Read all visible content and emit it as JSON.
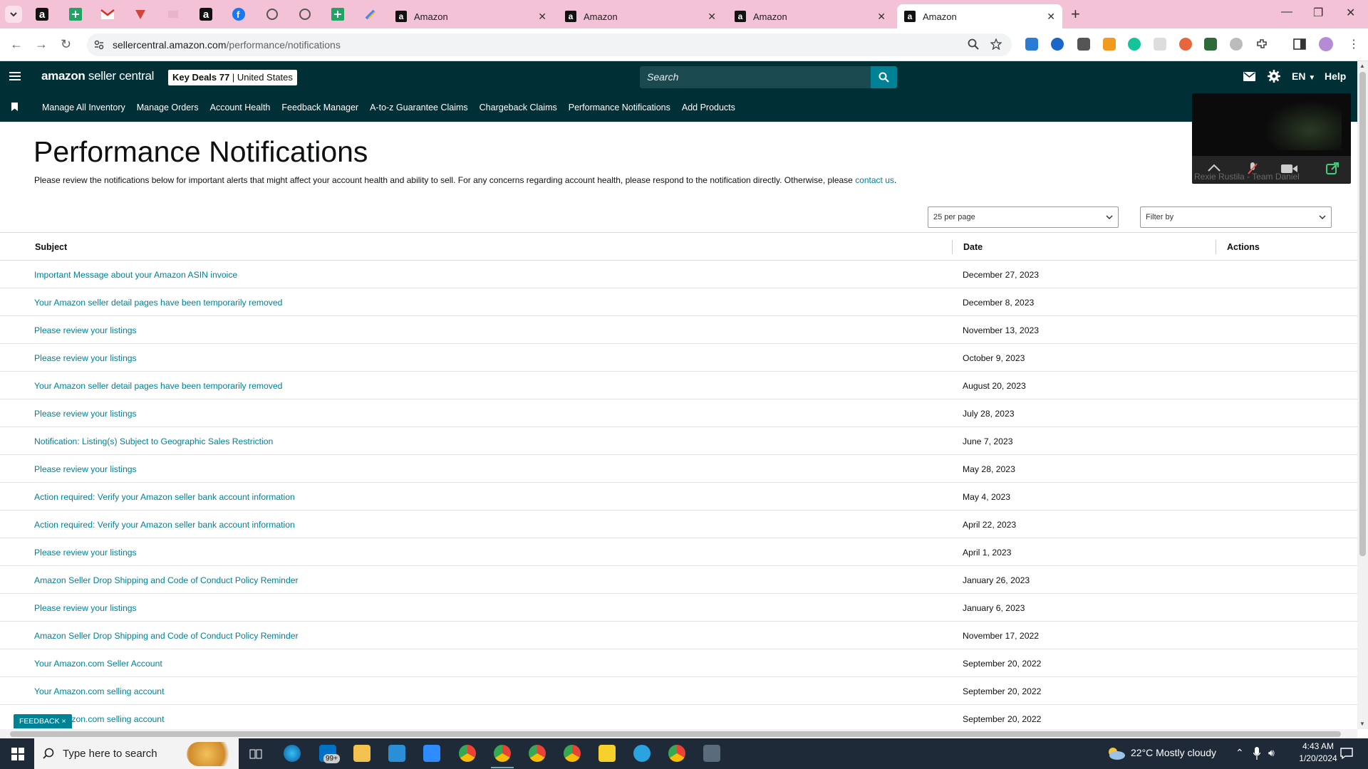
{
  "browser": {
    "tabs": [
      {
        "title": "Amazon"
      },
      {
        "title": "Amazon"
      },
      {
        "title": "Amazon"
      },
      {
        "title": "Amazon"
      }
    ],
    "url_host": "sellercentral.amazon.com",
    "url_path": "/performance/notifications"
  },
  "header": {
    "logo_main": "amazon",
    "logo_rest": " seller central",
    "store_name": "Key Deals 77",
    "store_sep": " | ",
    "store_country": "United States",
    "search_placeholder": "Search",
    "language": "EN",
    "help": "Help"
  },
  "nav": {
    "items": [
      "Manage All Inventory",
      "Manage Orders",
      "Account Health",
      "Feedback Manager",
      "A-to-z Guarantee Claims",
      "Chargeback Claims",
      "Performance Notifications",
      "Add Products"
    ]
  },
  "page": {
    "title": "Performance Notifications",
    "intro": "Please review the notifications below for important alerts that might affect your account health and ability to sell. For any concerns regarding account health, please respond to the notification directly. Otherwise, please ",
    "intro_link": "contact us",
    "intro_end": ".",
    "per_page": "25 per page",
    "filter_placeholder": "Filter by"
  },
  "table": {
    "columns": {
      "subject": "Subject",
      "date": "Date",
      "actions": "Actions"
    },
    "rows": [
      {
        "subject": "Important Message about your Amazon ASIN invoice",
        "date": "December 27, 2023"
      },
      {
        "subject": "Your Amazon seller detail pages have been temporarily removed",
        "date": "December 8, 2023"
      },
      {
        "subject": "Please review your listings",
        "date": "November 13, 2023"
      },
      {
        "subject": "Please review your listings",
        "date": "October 9, 2023"
      },
      {
        "subject": "Your Amazon seller detail pages have been temporarily removed",
        "date": "August 20, 2023"
      },
      {
        "subject": "Please review your listings",
        "date": "July 28, 2023"
      },
      {
        "subject": "Notification: Listing(s) Subject to Geographic Sales Restriction",
        "date": "June 7, 2023"
      },
      {
        "subject": "Please review your listings",
        "date": "May 28, 2023"
      },
      {
        "subject": "Action required: Verify your Amazon seller bank account information",
        "date": "May 4, 2023"
      },
      {
        "subject": "Action required: Verify your Amazon seller bank account information",
        "date": "April 22, 2023"
      },
      {
        "subject": "Please review your listings",
        "date": "April 1, 2023"
      },
      {
        "subject": "Amazon Seller Drop Shipping and Code of Conduct Policy Reminder",
        "date": "January 26, 2023"
      },
      {
        "subject": "Please review your listings",
        "date": "January 6, 2023"
      },
      {
        "subject": "Amazon Seller Drop Shipping and Code of Conduct Policy Reminder",
        "date": "November 17, 2022"
      },
      {
        "subject": "Your Amazon.com Seller Account",
        "date": "September 20, 2022"
      },
      {
        "subject": "Your Amazon.com selling account",
        "date": "September 20, 2022"
      },
      {
        "subject": "Your Amazon.com selling account",
        "date": "September 20, 2022"
      }
    ]
  },
  "feedback": "FEEDBACK ×",
  "video_overlay": {
    "participant": "Rexie Rustila - Team Daniel"
  },
  "taskbar": {
    "search_placeholder": "Type here to search",
    "badge_count": "99+",
    "weather": "22°C  Mostly cloudy",
    "time": "4:43 AM",
    "date": "1/20/2024"
  },
  "colors": {
    "header_bg": "#002f36",
    "link": "#008296",
    "tabbar_bg": "#f4c2d6"
  }
}
